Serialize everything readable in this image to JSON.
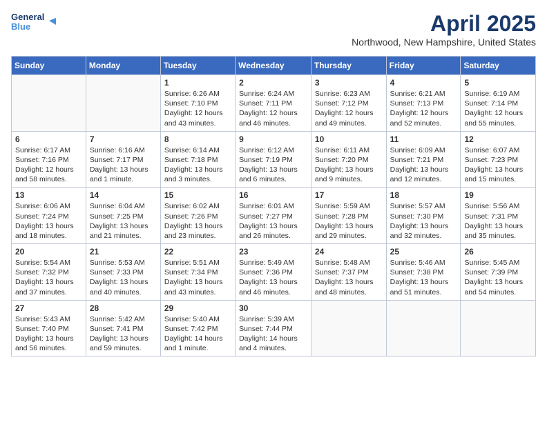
{
  "header": {
    "logo_line1": "General",
    "logo_line2": "Blue",
    "month": "April 2025",
    "location": "Northwood, New Hampshire, United States"
  },
  "days_of_week": [
    "Sunday",
    "Monday",
    "Tuesday",
    "Wednesday",
    "Thursday",
    "Friday",
    "Saturday"
  ],
  "weeks": [
    [
      {
        "day": "",
        "content": ""
      },
      {
        "day": "",
        "content": ""
      },
      {
        "day": "1",
        "content": "Sunrise: 6:26 AM\nSunset: 7:10 PM\nDaylight: 12 hours and 43 minutes."
      },
      {
        "day": "2",
        "content": "Sunrise: 6:24 AM\nSunset: 7:11 PM\nDaylight: 12 hours and 46 minutes."
      },
      {
        "day": "3",
        "content": "Sunrise: 6:23 AM\nSunset: 7:12 PM\nDaylight: 12 hours and 49 minutes."
      },
      {
        "day": "4",
        "content": "Sunrise: 6:21 AM\nSunset: 7:13 PM\nDaylight: 12 hours and 52 minutes."
      },
      {
        "day": "5",
        "content": "Sunrise: 6:19 AM\nSunset: 7:14 PM\nDaylight: 12 hours and 55 minutes."
      }
    ],
    [
      {
        "day": "6",
        "content": "Sunrise: 6:17 AM\nSunset: 7:16 PM\nDaylight: 12 hours and 58 minutes."
      },
      {
        "day": "7",
        "content": "Sunrise: 6:16 AM\nSunset: 7:17 PM\nDaylight: 13 hours and 1 minute."
      },
      {
        "day": "8",
        "content": "Sunrise: 6:14 AM\nSunset: 7:18 PM\nDaylight: 13 hours and 3 minutes."
      },
      {
        "day": "9",
        "content": "Sunrise: 6:12 AM\nSunset: 7:19 PM\nDaylight: 13 hours and 6 minutes."
      },
      {
        "day": "10",
        "content": "Sunrise: 6:11 AM\nSunset: 7:20 PM\nDaylight: 13 hours and 9 minutes."
      },
      {
        "day": "11",
        "content": "Sunrise: 6:09 AM\nSunset: 7:21 PM\nDaylight: 13 hours and 12 minutes."
      },
      {
        "day": "12",
        "content": "Sunrise: 6:07 AM\nSunset: 7:23 PM\nDaylight: 13 hours and 15 minutes."
      }
    ],
    [
      {
        "day": "13",
        "content": "Sunrise: 6:06 AM\nSunset: 7:24 PM\nDaylight: 13 hours and 18 minutes."
      },
      {
        "day": "14",
        "content": "Sunrise: 6:04 AM\nSunset: 7:25 PM\nDaylight: 13 hours and 21 minutes."
      },
      {
        "day": "15",
        "content": "Sunrise: 6:02 AM\nSunset: 7:26 PM\nDaylight: 13 hours and 23 minutes."
      },
      {
        "day": "16",
        "content": "Sunrise: 6:01 AM\nSunset: 7:27 PM\nDaylight: 13 hours and 26 minutes."
      },
      {
        "day": "17",
        "content": "Sunrise: 5:59 AM\nSunset: 7:28 PM\nDaylight: 13 hours and 29 minutes."
      },
      {
        "day": "18",
        "content": "Sunrise: 5:57 AM\nSunset: 7:30 PM\nDaylight: 13 hours and 32 minutes."
      },
      {
        "day": "19",
        "content": "Sunrise: 5:56 AM\nSunset: 7:31 PM\nDaylight: 13 hours and 35 minutes."
      }
    ],
    [
      {
        "day": "20",
        "content": "Sunrise: 5:54 AM\nSunset: 7:32 PM\nDaylight: 13 hours and 37 minutes."
      },
      {
        "day": "21",
        "content": "Sunrise: 5:53 AM\nSunset: 7:33 PM\nDaylight: 13 hours and 40 minutes."
      },
      {
        "day": "22",
        "content": "Sunrise: 5:51 AM\nSunset: 7:34 PM\nDaylight: 13 hours and 43 minutes."
      },
      {
        "day": "23",
        "content": "Sunrise: 5:49 AM\nSunset: 7:36 PM\nDaylight: 13 hours and 46 minutes."
      },
      {
        "day": "24",
        "content": "Sunrise: 5:48 AM\nSunset: 7:37 PM\nDaylight: 13 hours and 48 minutes."
      },
      {
        "day": "25",
        "content": "Sunrise: 5:46 AM\nSunset: 7:38 PM\nDaylight: 13 hours and 51 minutes."
      },
      {
        "day": "26",
        "content": "Sunrise: 5:45 AM\nSunset: 7:39 PM\nDaylight: 13 hours and 54 minutes."
      }
    ],
    [
      {
        "day": "27",
        "content": "Sunrise: 5:43 AM\nSunset: 7:40 PM\nDaylight: 13 hours and 56 minutes."
      },
      {
        "day": "28",
        "content": "Sunrise: 5:42 AM\nSunset: 7:41 PM\nDaylight: 13 hours and 59 minutes."
      },
      {
        "day": "29",
        "content": "Sunrise: 5:40 AM\nSunset: 7:42 PM\nDaylight: 14 hours and 1 minute."
      },
      {
        "day": "30",
        "content": "Sunrise: 5:39 AM\nSunset: 7:44 PM\nDaylight: 14 hours and 4 minutes."
      },
      {
        "day": "",
        "content": ""
      },
      {
        "day": "",
        "content": ""
      },
      {
        "day": "",
        "content": ""
      }
    ]
  ]
}
